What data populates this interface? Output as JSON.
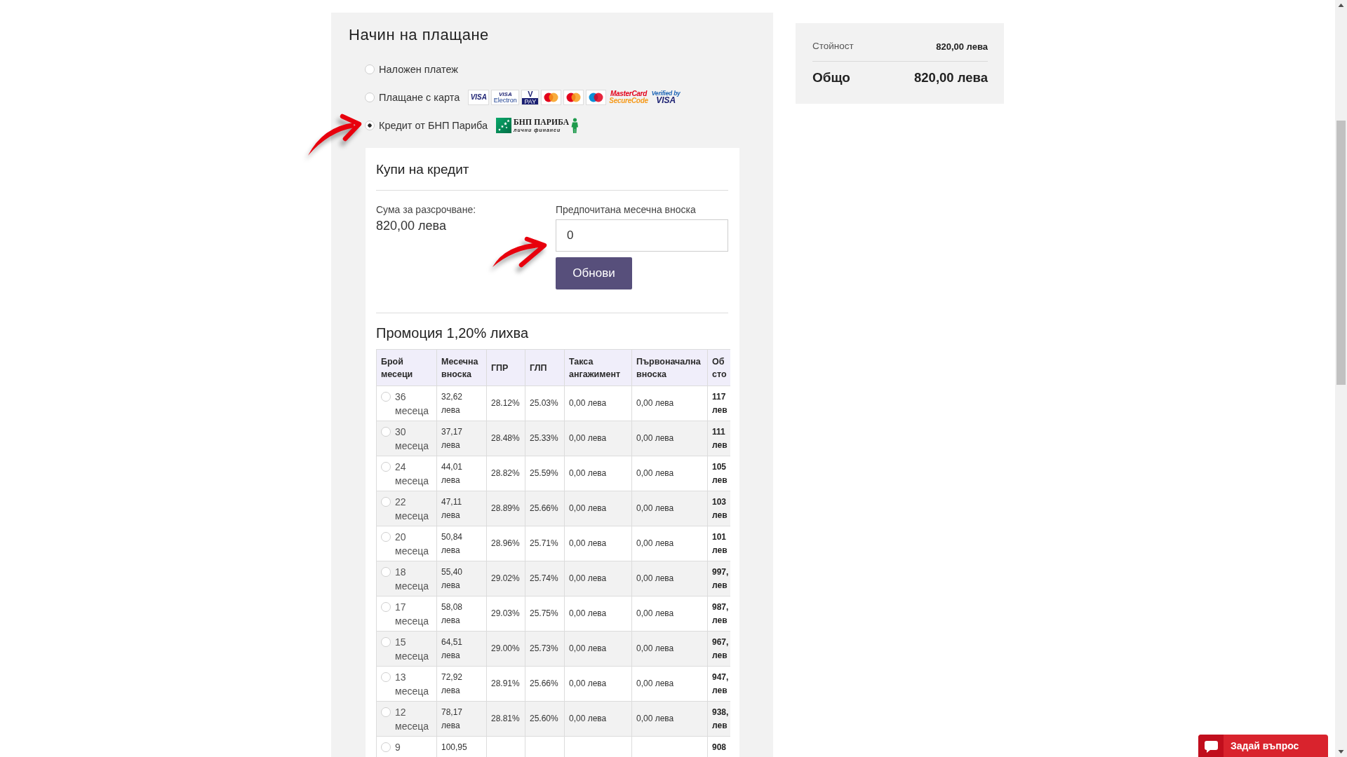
{
  "payment": {
    "title": "Начин на плащане",
    "methods": [
      {
        "label": "Наложен платеж",
        "selected": false
      },
      {
        "label": "Плащане с карта",
        "selected": false,
        "logos": [
          {
            "kind": "visa",
            "text": "VISA"
          },
          {
            "kind": "visa_electron",
            "text": "VISA",
            "subtext": "Electron"
          },
          {
            "kind": "vpay",
            "text": "V",
            "subtext": "PAY"
          },
          {
            "kind": "mastercard"
          },
          {
            "kind": "mastercard"
          },
          {
            "kind": "maestro"
          },
          {
            "kind": "securecode",
            "text": "MasterCard",
            "subtext": "SecureCode"
          },
          {
            "kind": "verified",
            "text": "Verified by",
            "subtext": "VISA"
          }
        ]
      },
      {
        "label": "Кредит от БНП Париба",
        "selected": true,
        "logos": [
          {
            "kind": "bnp",
            "text": "БНП ПАРИБА",
            "subtext": "лични финанси"
          }
        ]
      }
    ]
  },
  "credit": {
    "title": "Купи на кредит",
    "amount_label": "Сума за разсрочване:",
    "amount": "820,00 лева",
    "installment_label": "Предпочитана месечна вноска",
    "installment_value": "0",
    "update_button": "Обнови",
    "promo_title": "Промоция 1,20% лихва",
    "table": {
      "columns": [
        "Брой месеци",
        "Месечна вноска",
        "ГПР",
        "ГЛП",
        "Такса ангажимент",
        "Първоначална вноска",
        "Об сто"
      ],
      "rows": [
        {
          "selected": false,
          "months": "36 месеца",
          "monthly": "32,62 лева",
          "gpr": "28.12%",
          "glp": "25.03%",
          "fee": "0,00 лева",
          "down_payment": "0,00 лева",
          "total": "117 лев"
        },
        {
          "selected": false,
          "months": "30 месеца",
          "monthly": "37,17 лева",
          "gpr": "28.48%",
          "glp": "25.33%",
          "fee": "0,00 лева",
          "down_payment": "0,00 лева",
          "total": "111 лев"
        },
        {
          "selected": false,
          "months": "24 месеца",
          "monthly": "44,01 лева",
          "gpr": "28.82%",
          "glp": "25.59%",
          "fee": "0,00 лева",
          "down_payment": "0,00 лева",
          "total": "105 лев"
        },
        {
          "selected": false,
          "months": "22 месеца",
          "monthly": "47,11 лева",
          "gpr": "28.89%",
          "glp": "25.66%",
          "fee": "0,00 лева",
          "down_payment": "0,00 лева",
          "total": "103 лев"
        },
        {
          "selected": false,
          "months": "20 месеца",
          "monthly": "50,84 лева",
          "gpr": "28.96%",
          "glp": "25.71%",
          "fee": "0,00 лева",
          "down_payment": "0,00 лева",
          "total": "101 лев"
        },
        {
          "selected": false,
          "months": "18 месеца",
          "monthly": "55,40 лева",
          "gpr": "29.02%",
          "glp": "25.74%",
          "fee": "0,00 лева",
          "down_payment": "0,00 лева",
          "total": "997, лев"
        },
        {
          "selected": false,
          "months": "17 месеца",
          "monthly": "58,08 лева",
          "gpr": "29.03%",
          "glp": "25.75%",
          "fee": "0,00 лева",
          "down_payment": "0,00 лева",
          "total": "987, лев"
        },
        {
          "selected": false,
          "months": "15 месеца",
          "monthly": "64,51 лева",
          "gpr": "29.00%",
          "glp": "25.73%",
          "fee": "0,00 лева",
          "down_payment": "0,00 лева",
          "total": "967, лев"
        },
        {
          "selected": false,
          "months": "13 месеца",
          "monthly": "72,92 лева",
          "gpr": "28.91%",
          "glp": "25.66%",
          "fee": "0,00 лева",
          "down_payment": "0,00 лева",
          "total": "947, лев"
        },
        {
          "selected": false,
          "months": "12 месеца",
          "monthly": "78,17 лева",
          "gpr": "28.81%",
          "glp": "25.60%",
          "fee": "0,00 лева",
          "down_payment": "0,00 лева",
          "total": "938, лев"
        },
        {
          "selected": false,
          "months": "9",
          "monthly": "100,95",
          "total": "908"
        }
      ]
    }
  },
  "summary": {
    "rows": [
      {
        "kind": "subtotal",
        "label": "Стойност",
        "value": "820,00 лева"
      },
      {
        "kind": "total",
        "label": "Общо",
        "value": "820,00 лева"
      }
    ]
  },
  "chat_button": {
    "label": "Задай въпрос"
  }
}
